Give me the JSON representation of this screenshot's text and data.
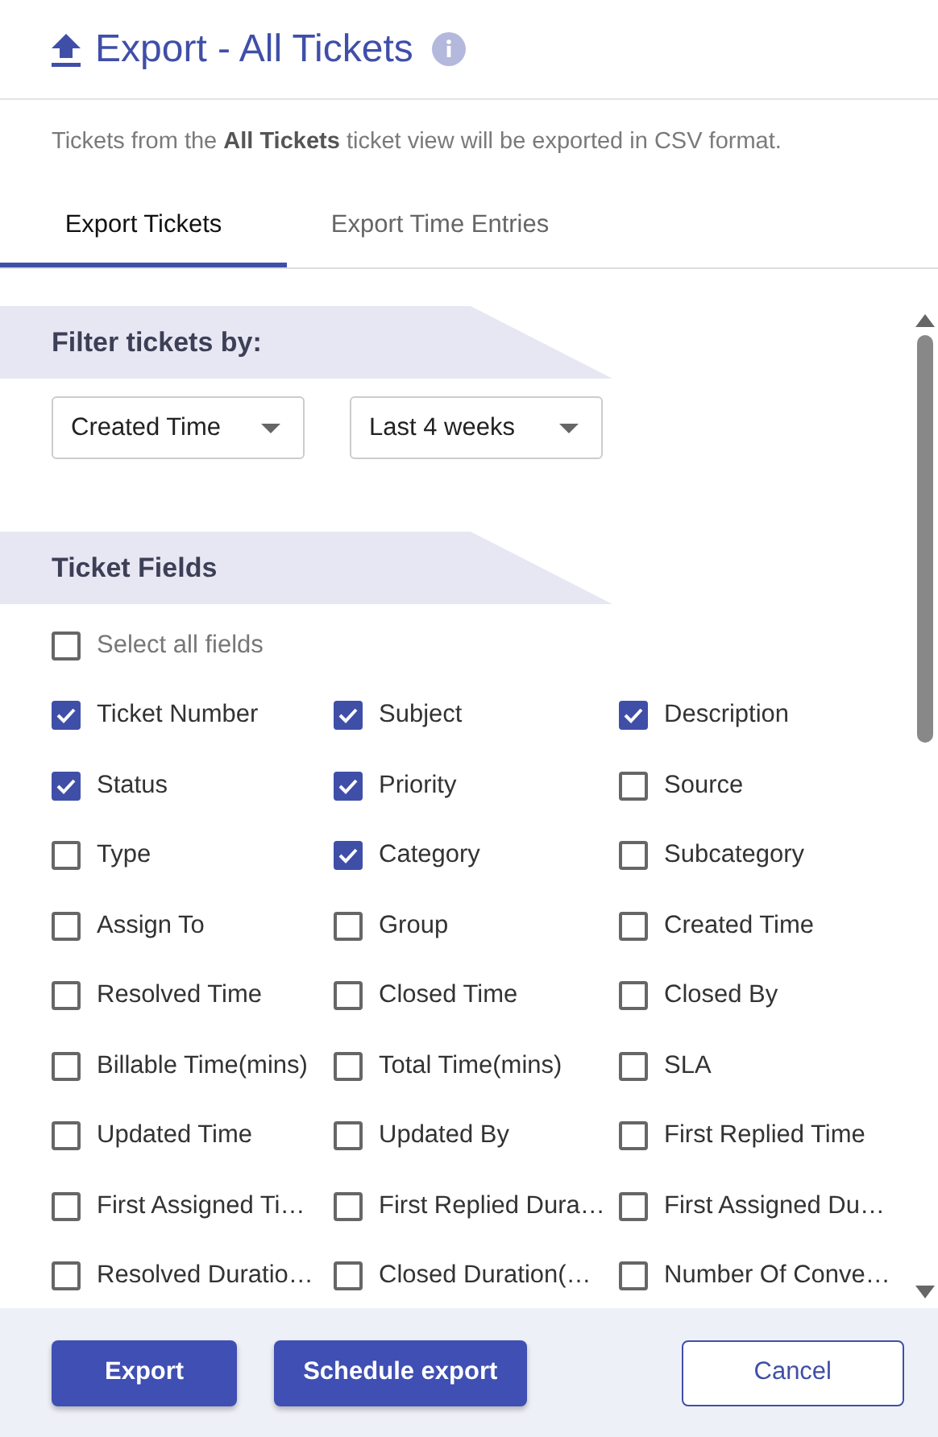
{
  "header": {
    "title": "Export - All Tickets"
  },
  "description": "Tickets from the **All Tickets** ticket view will be exported in CSV format.",
  "tabs": [
    {
      "label": "Export Tickets",
      "selected": true
    },
    {
      "label": "Export Time Entries",
      "selected": false
    }
  ],
  "filter": {
    "heading": "Filter tickets by:",
    "dropdowns": [
      {
        "value": "Created Time"
      },
      {
        "value": "Last 4 weeks"
      }
    ]
  },
  "ticket_fields": {
    "heading": "Ticket Fields",
    "select_all": {
      "label": "Select all fields",
      "checked": false
    },
    "fields": [
      {
        "label": "Ticket Number",
        "checked": true
      },
      {
        "label": "Subject",
        "checked": true
      },
      {
        "label": "Description",
        "checked": true
      },
      {
        "label": "Status",
        "checked": true
      },
      {
        "label": "Priority",
        "checked": true
      },
      {
        "label": "Source",
        "checked": false
      },
      {
        "label": "Type",
        "checked": false
      },
      {
        "label": "Category",
        "checked": true
      },
      {
        "label": "Subcategory",
        "checked": false
      },
      {
        "label": "Assign To",
        "checked": false
      },
      {
        "label": "Group",
        "checked": false
      },
      {
        "label": "Created Time",
        "checked": false
      },
      {
        "label": "Resolved Time",
        "checked": false
      },
      {
        "label": "Closed Time",
        "checked": false
      },
      {
        "label": "Closed By",
        "checked": false
      },
      {
        "label": "Billable Time(mins)",
        "checked": false
      },
      {
        "label": "Total Time(mins)",
        "checked": false
      },
      {
        "label": "SLA",
        "checked": false
      },
      {
        "label": "Updated Time",
        "checked": false
      },
      {
        "label": "Updated By",
        "checked": false
      },
      {
        "label": "First Replied Time",
        "checked": false
      },
      {
        "label": "First Assigned Ti…",
        "checked": false
      },
      {
        "label": "First Replied Dura…",
        "checked": false
      },
      {
        "label": "First Assigned Du…",
        "checked": false
      },
      {
        "label": "Resolved Duratio…",
        "checked": false
      },
      {
        "label": "Closed Duration(…",
        "checked": false
      },
      {
        "label": "Number Of Conve…",
        "checked": false
      }
    ]
  },
  "buttons": [
    {
      "label": "Export",
      "kind": "primary"
    },
    {
      "label": "Schedule export",
      "kind": "primary"
    },
    {
      "label": "Cancel",
      "kind": "secondary"
    }
  ]
}
